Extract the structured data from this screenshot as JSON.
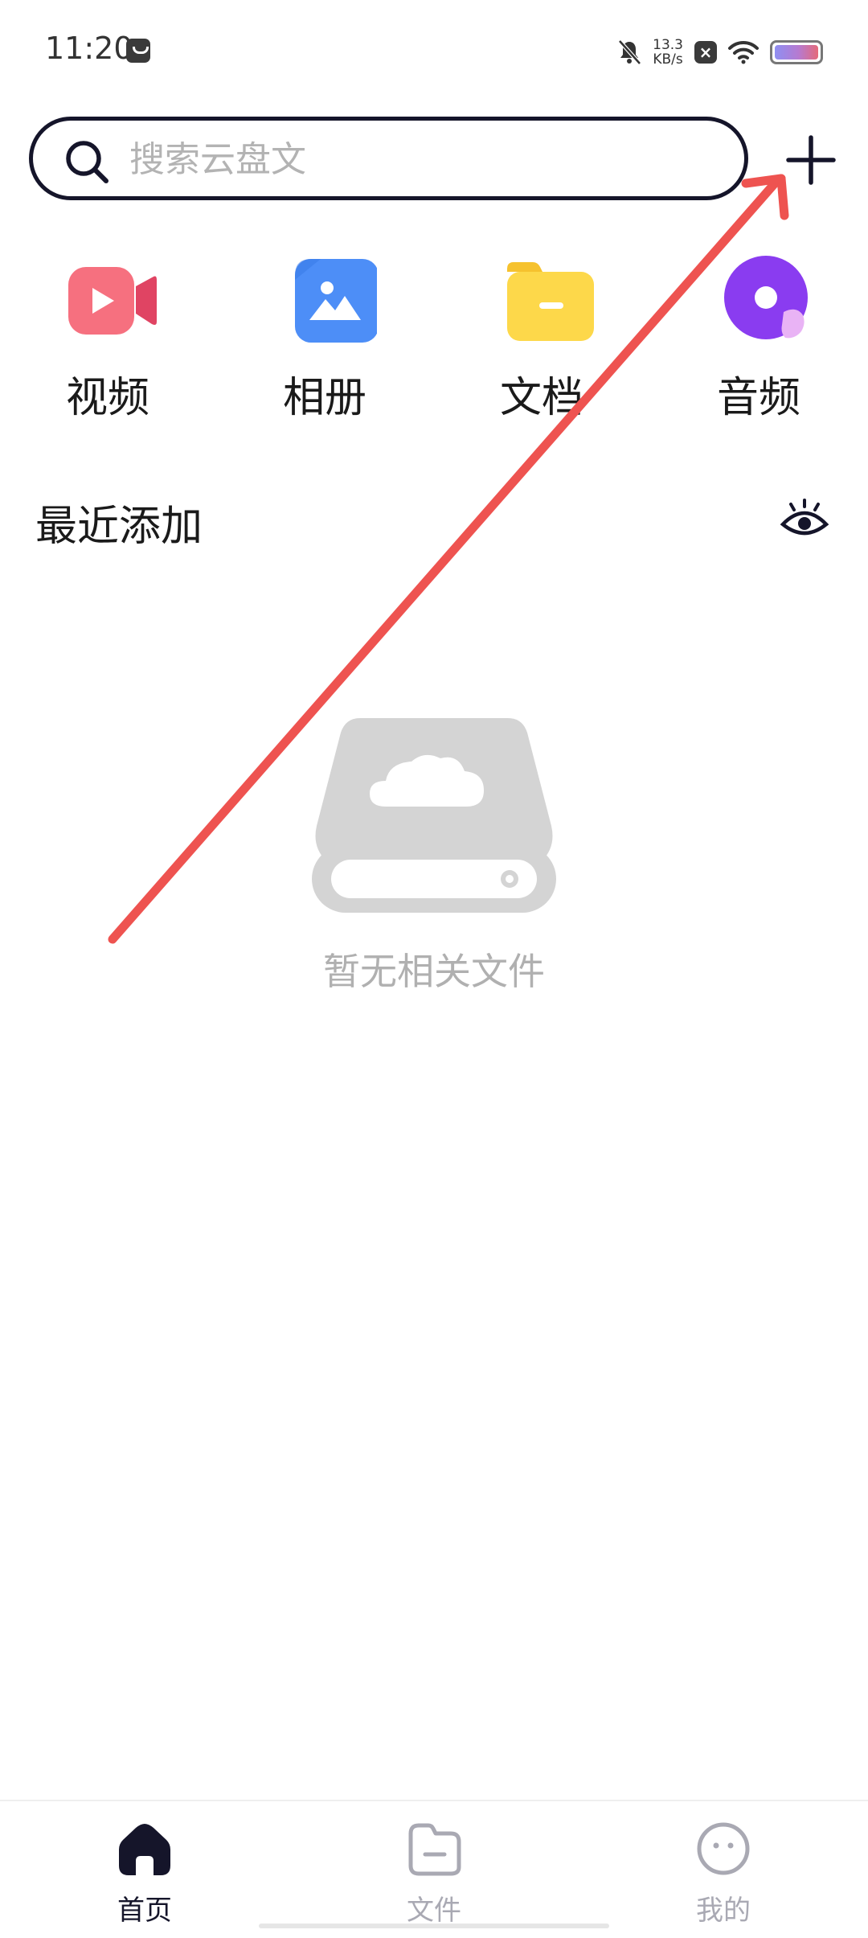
{
  "status_bar": {
    "time": "11:20",
    "net_speed_value": "13.3",
    "net_speed_unit": "KB/s"
  },
  "search": {
    "placeholder": "搜索云盘文"
  },
  "categories": [
    {
      "label": "视频",
      "icon": "video-camera-icon",
      "color": "#F0566E"
    },
    {
      "label": "相册",
      "icon": "photo-album-icon",
      "color": "#4D8EF7"
    },
    {
      "label": "文档",
      "icon": "document-folder-icon",
      "color": "#FDD84A"
    },
    {
      "label": "音频",
      "icon": "audio-disc-icon",
      "color": "#8A3CF0"
    }
  ],
  "recent": {
    "title": "最近添加"
  },
  "empty_state": {
    "message": "暂无相关文件"
  },
  "bottom_nav": [
    {
      "label": "首页",
      "icon": "home-icon",
      "active": true
    },
    {
      "label": "文件",
      "icon": "files-folder-icon",
      "active": false
    },
    {
      "label": "我的",
      "icon": "profile-face-icon",
      "active": false
    }
  ],
  "colors": {
    "active": "#15152a",
    "inactive": "#a9a9b3",
    "annotation_arrow": "#EE5350"
  }
}
